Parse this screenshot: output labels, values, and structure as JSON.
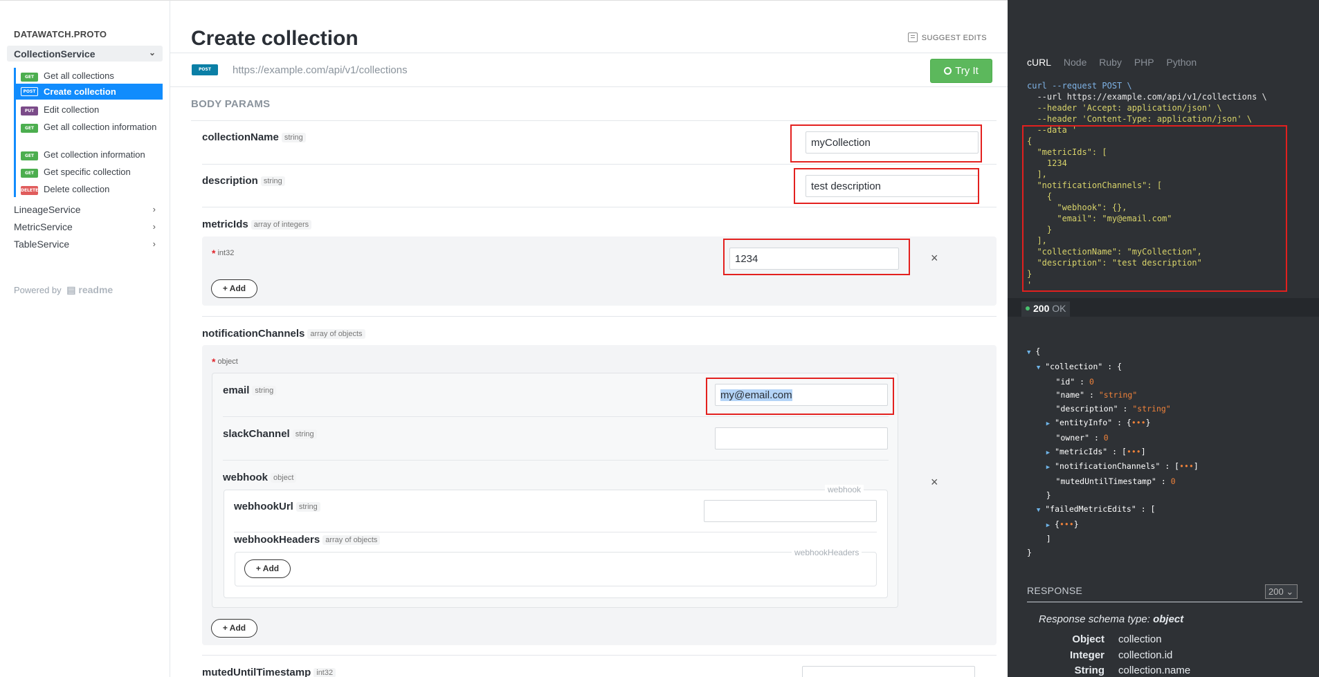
{
  "sidebar": {
    "brand": "DATAWATCH.PROTO",
    "group": "CollectionService",
    "items": [
      {
        "method": "GET",
        "label": "Get all collections"
      },
      {
        "method": "POST",
        "label": "Create collection"
      },
      {
        "method": "PUT",
        "label": "Edit collection"
      },
      {
        "method": "GET",
        "label": "Get all collection information"
      },
      {
        "method": "GET",
        "label": "Get collection information"
      },
      {
        "method": "GET",
        "label": "Get specific collection"
      },
      {
        "method": "DELETE",
        "label": "Delete collection"
      }
    ],
    "services": [
      "LineageService",
      "MetricService",
      "TableService"
    ],
    "powered_by": "Powered by",
    "powered_brand": "readme"
  },
  "main": {
    "title": "Create collection",
    "suggest_edits": "SUGGEST EDITS",
    "method": "POST",
    "url": "https://example.com/api/v1/collections",
    "try_it": "Try It",
    "body_params": "BODY PARAMS",
    "params": {
      "collectionName": {
        "name": "collectionName",
        "type": "string",
        "value": "myCollection"
      },
      "description": {
        "name": "description",
        "type": "string",
        "value": "test description"
      },
      "metricIds": {
        "name": "metricIds",
        "type": "array of integers",
        "item_type": "int32",
        "value": "1234",
        "add": "+ Add"
      },
      "notificationChannels": {
        "name": "notificationChannels",
        "type": "array of objects",
        "item_type": "object",
        "add": "+ Add"
      },
      "email": {
        "name": "email",
        "type": "string",
        "value": "my@email.com"
      },
      "slackChannel": {
        "name": "slackChannel",
        "type": "string",
        "value": ""
      },
      "webhook": {
        "name": "webhook",
        "type": "object",
        "legend": "webhook"
      },
      "webhookUrl": {
        "name": "webhookUrl",
        "type": "string",
        "value": ""
      },
      "webhookHeaders": {
        "name": "webhookHeaders",
        "type": "array of objects",
        "legend": "webhookHeaders",
        "add": "+ Add"
      },
      "mutedUntilTimestamp": {
        "name": "mutedUntilTimestamp",
        "type": "int32"
      }
    },
    "remove_symbol": "×"
  },
  "right": {
    "languages": [
      "cURL",
      "Node",
      "Ruby",
      "PHP",
      "Python"
    ],
    "active_language": "cURL",
    "code_lines": [
      "curl --request POST \\",
      "  --url https://example.com/api/v1/collections \\",
      "  --header 'Accept: application/json' \\",
      "  --header 'Content-Type: application/json' \\",
      "  --data '",
      "{",
      "  \"metricIds\": [",
      "    1234",
      "  ],",
      "  \"notificationChannels\": [",
      "    {",
      "      \"webhook\": {},",
      "      \"email\": \"my@email.com\"",
      "    }",
      "  ],",
      "  \"collectionName\": \"myCollection\",",
      "  \"description\": \"test description\"",
      "}",
      "'"
    ],
    "status_code": "200",
    "status_text": "OK",
    "response_title": "RESPONSE",
    "response_select": "200",
    "schema_type_label": "Response schema type:",
    "schema_type": "object",
    "schema_rows": [
      {
        "type": "Object",
        "field": "collection"
      },
      {
        "type": "Integer",
        "field": "collection.id"
      },
      {
        "type": "String",
        "field": "collection.name"
      }
    ],
    "json_preview": {
      "collection_key": "\"collection\"",
      "id_key": "\"id\"",
      "id_val": "0",
      "name_key": "\"name\"",
      "name_val": "\"string\"",
      "desc_key": "\"description\"",
      "desc_val": "\"string\"",
      "entity_key": "\"entityInfo\"",
      "owner_key": "\"owner\"",
      "owner_val": "0",
      "metric_key": "\"metricIds\"",
      "notif_key": "\"notificationChannels\"",
      "muted_key": "\"mutedUntilTimestamp\"",
      "muted_val": "0",
      "failed_key": "\"failedMetricEdits\""
    }
  }
}
